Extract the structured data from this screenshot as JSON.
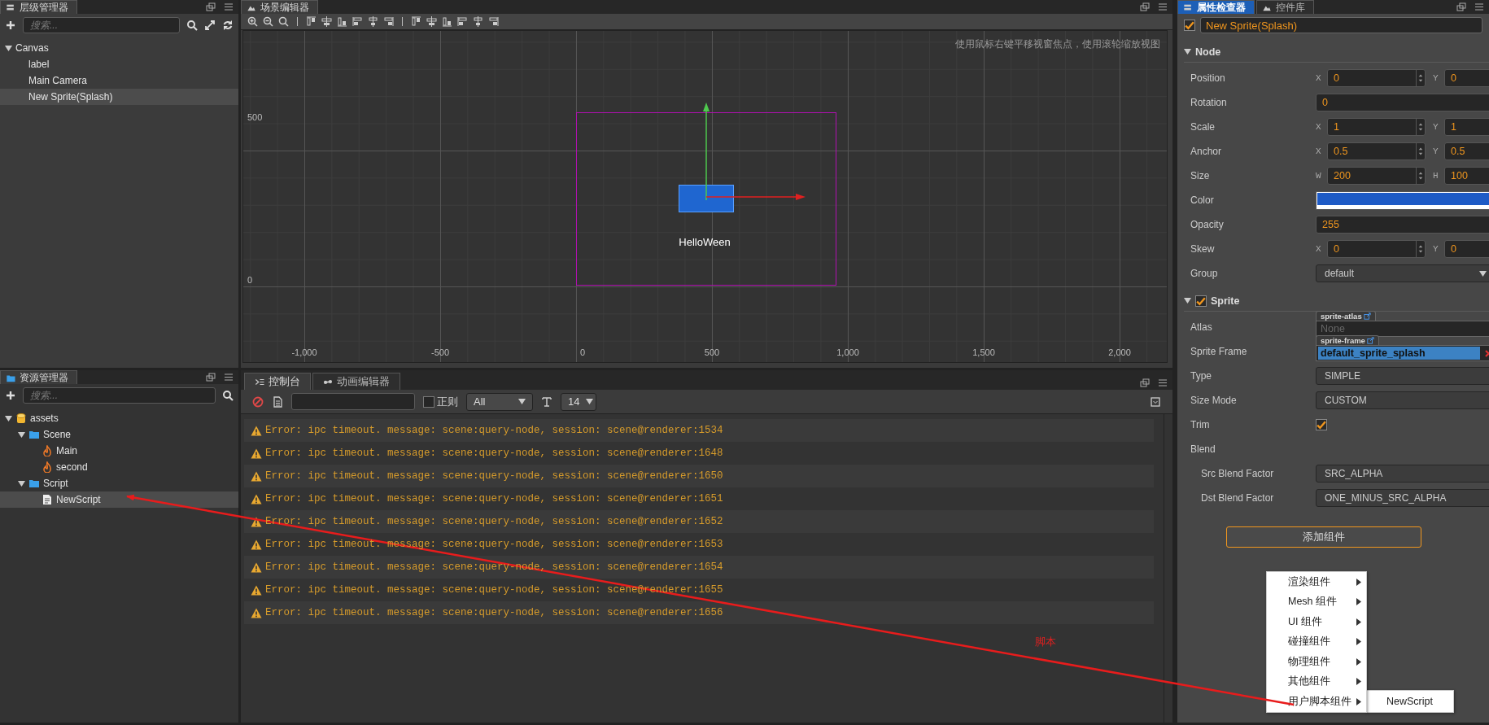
{
  "hierarchy": {
    "title": "层级管理器",
    "search": {
      "placeholder": "搜索..."
    },
    "tree": [
      {
        "label": "Canvas",
        "expanded": true,
        "selected": false,
        "children": [
          {
            "label": "label",
            "selected": false
          },
          {
            "label": "Main Camera",
            "selected": false
          },
          {
            "label": "New Sprite(Splash)",
            "selected": true
          }
        ]
      }
    ]
  },
  "scene": {
    "title": "场景编辑器",
    "hint": "使用鼠标右键平移视窗焦点，使用滚轮缩放视图",
    "y_labels": [
      "500",
      "0"
    ],
    "x_labels": [
      "-1,000",
      "-500",
      "0",
      "500",
      "1,000",
      "1,500",
      "2,000"
    ],
    "node_label": "HelloWeen"
  },
  "assets": {
    "title": "资源管理器",
    "search": {
      "placeholder": "搜索..."
    },
    "tree": [
      {
        "label": "assets",
        "kind": "db",
        "expanded": true,
        "selected": false,
        "children": [
          {
            "label": "Scene",
            "kind": "folder",
            "expanded": true,
            "selected": false,
            "children": [
              {
                "label": "Main",
                "kind": "scene",
                "selected": false
              },
              {
                "label": "second",
                "kind": "scene",
                "selected": false
              }
            ]
          },
          {
            "label": "Script",
            "kind": "folder",
            "expanded": true,
            "selected": false,
            "children": [
              {
                "label": "NewScript",
                "kind": "script",
                "selected": true
              }
            ]
          }
        ]
      }
    ]
  },
  "console": {
    "tabs": [
      {
        "label": "控制台",
        "selected": true
      },
      {
        "label": "动画编辑器",
        "selected": false
      }
    ],
    "regex": {
      "label": "正则",
      "checked": false
    },
    "level_filter": "All",
    "font_size": "14",
    "messages": [
      "Error: ipc timeout. message: scene:query-node, session: scene@renderer:1534",
      "Error: ipc timeout. message: scene:query-node, session: scene@renderer:1648",
      "Error: ipc timeout. message: scene:query-node, session: scene@renderer:1650",
      "Error: ipc timeout. message: scene:query-node, session: scene@renderer:1651",
      "Error: ipc timeout. message: scene:query-node, session: scene@renderer:1652",
      "Error: ipc timeout. message: scene:query-node, session: scene@renderer:1653",
      "Error: ipc timeout. message: scene:query-node, session: scene@renderer:1654",
      "Error: ipc timeout. message: scene:query-node, session: scene@renderer:1655",
      "Error: ipc timeout. message: scene:query-node, session: scene@renderer:1656"
    ]
  },
  "inspector": {
    "tabs": [
      {
        "label": "属性检查器",
        "selected": true
      },
      {
        "label": "控件库",
        "selected": false
      }
    ],
    "node_active": true,
    "node_name": "New Sprite(Splash)",
    "sections": [
      {
        "title": "Node",
        "expanded": true,
        "rows": [
          {
            "kind": "xy",
            "label": "Position",
            "axes": [
              "X",
              "Y"
            ],
            "values": [
              "0",
              "0"
            ]
          },
          {
            "kind": "single",
            "label": "Rotation",
            "value": "0"
          },
          {
            "kind": "xy",
            "label": "Scale",
            "axes": [
              "X",
              "Y"
            ],
            "values": [
              "1",
              "1"
            ]
          },
          {
            "kind": "xy",
            "label": "Anchor",
            "axes": [
              "X",
              "Y"
            ],
            "values": [
              "0.5",
              "0.5"
            ]
          },
          {
            "kind": "xy",
            "label": "Size",
            "axes": [
              "W",
              "H"
            ],
            "values": [
              "200",
              "100"
            ]
          },
          {
            "kind": "color",
            "label": "Color",
            "color": "#1e5bc6"
          },
          {
            "kind": "single",
            "label": "Opacity",
            "value": "255"
          },
          {
            "kind": "xy",
            "label": "Skew",
            "axes": [
              "X",
              "Y"
            ],
            "values": [
              "0",
              "0"
            ]
          },
          {
            "kind": "select",
            "label": "Group",
            "value": "default"
          }
        ]
      },
      {
        "title": "Sprite",
        "expanded": true,
        "enabled": true,
        "rows": [
          {
            "kind": "asset",
            "label": "Atlas",
            "tag": "sprite-atlas",
            "placeholder": "None",
            "empty": true
          },
          {
            "kind": "asset",
            "label": "Sprite Frame",
            "tag": "sprite-frame",
            "value": "default_sprite_splash",
            "empty": false
          },
          {
            "kind": "plain",
            "label": "Type",
            "value": "SIMPLE"
          },
          {
            "kind": "plain",
            "label": "Size Mode",
            "value": "CUSTOM"
          },
          {
            "kind": "check",
            "label": "Trim",
            "checked": true
          },
          {
            "kind": "group",
            "label": "Blend",
            "children": [
              {
                "kind": "plain",
                "label": "Src Blend Factor",
                "value": "SRC_ALPHA"
              },
              {
                "kind": "plain",
                "label": "Dst Blend Factor",
                "value": "ONE_MINUS_SRC_ALPHA"
              }
            ]
          }
        ]
      }
    ],
    "add_button": "添加组件",
    "menu": [
      {
        "label": "渲染组件",
        "has_submenu": true
      },
      {
        "label": "Mesh 组件",
        "has_submenu": true
      },
      {
        "label": "UI 组件",
        "has_submenu": true
      },
      {
        "label": "碰撞组件",
        "has_submenu": true
      },
      {
        "label": "物理组件",
        "has_submenu": true
      },
      {
        "label": "其他组件",
        "has_submenu": true
      },
      {
        "label": "用户脚本组件",
        "has_submenu": true,
        "submenu": [
          "NewScript"
        ]
      }
    ]
  },
  "annotation": {
    "text": "脚本"
  }
}
